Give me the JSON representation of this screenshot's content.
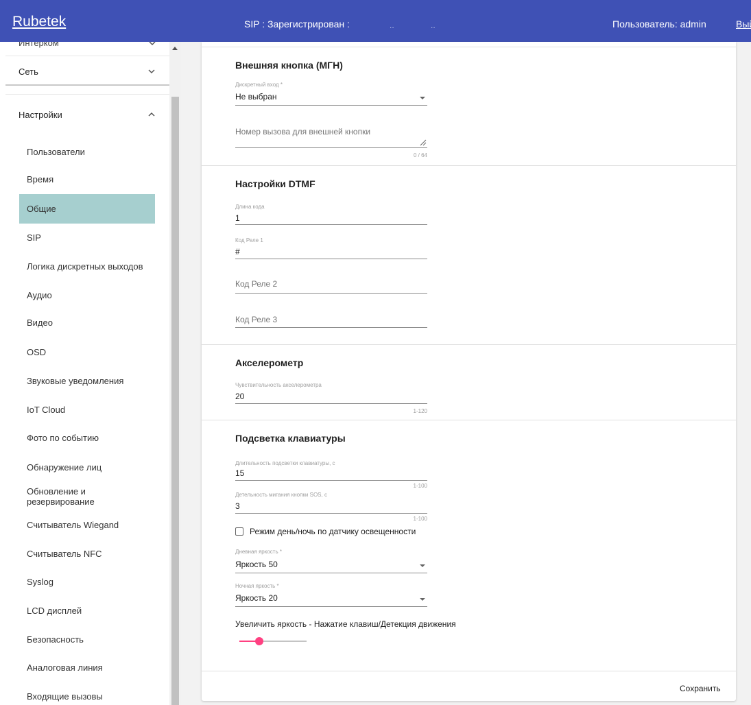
{
  "header": {
    "brand": "Rubetek",
    "sip_status": "SIP : Зарегистрирован :",
    "sip_dots": [
      "..",
      ".."
    ],
    "user": "Пользователь: admin",
    "logout": "Выйти"
  },
  "sidebar": {
    "cut_off_item": "Интерком",
    "network": "Сеть",
    "settings": "Настройки",
    "items": [
      "Пользователи",
      "Время",
      "Общие",
      "SIP",
      "Логика дискретных выходов",
      "Аудио",
      "Видео",
      "OSD",
      "Звуковые уведомления",
      "IoT Cloud",
      "Фото по событию",
      "Обнаружение лиц",
      "Обновление и резервирование",
      "Считыватель Wiegand",
      "Считыватель NFC",
      "Syslog",
      "LCD дисплей",
      "Безопасность",
      "Аналоговая линия",
      "Входящие вызовы"
    ],
    "active_item": "Общие"
  },
  "sections": {
    "ext_button": {
      "title": "Внешняя кнопка (МГН)",
      "discrete_label": "Дискретный вход *",
      "discrete_value": "Не выбран",
      "call_number_placeholder": "Номер вызова для внешней кнопки",
      "call_number_counter": "0 / 64"
    },
    "dtmf": {
      "title": "Настройки DTMF",
      "code_length_label": "Длина кода",
      "code_length_value": "1",
      "relay1_label": "Код Реле 1",
      "relay1_value": "#",
      "relay2_placeholder": "Код Реле 2",
      "relay3_placeholder": "Код Реле 3"
    },
    "accel": {
      "title": "Акселерометр",
      "sens_label": "Чувствительность акселерометра",
      "sens_value": "20",
      "sens_hint": "1-120"
    },
    "backlight": {
      "title": "Подсветка клавиатуры",
      "duration_label": "Длительность подсветки клавиатуры, с",
      "duration_value": "15",
      "duration_hint": "1-100",
      "sos_label": "Детельность мигания кнопки SOS, с",
      "sos_value": "3",
      "sos_hint": "1-100",
      "daynight_label": "Режим день/ночь по датчику освещенности",
      "daynight_checked": false,
      "day_label": "Дневная яркость *",
      "day_value": "Яркость 50",
      "night_label": "Ночная яркость *",
      "night_value": "Яркость 20",
      "increase_label": "Увеличить яркость - Нажатие клавиш/Детекция движения",
      "increase_level": 0.3
    }
  },
  "footer": {
    "save": "Сохранить"
  },
  "colors": {
    "topbar": "#3f51b5",
    "active_item": "#a6cfcf",
    "slider": "#ff4081"
  }
}
